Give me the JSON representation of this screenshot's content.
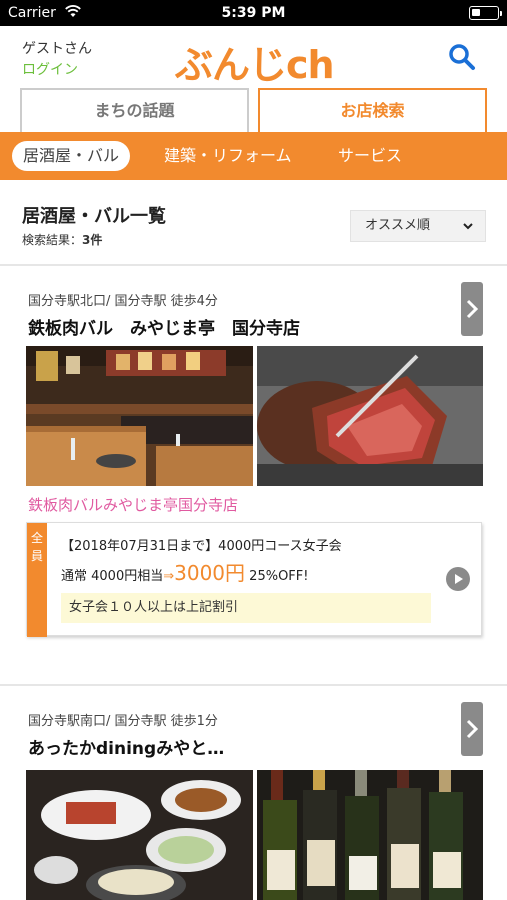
{
  "status_bar": {
    "carrier": "Carrier",
    "time": "5:39 PM"
  },
  "header": {
    "guest": "ゲストさん",
    "login": "ログイン",
    "logo": "ぶんじch"
  },
  "tabs": [
    {
      "label": "まちの話題"
    },
    {
      "label": "お店検索"
    }
  ],
  "categories": [
    {
      "label": "居酒屋・バル"
    },
    {
      "label": "建築・リフォーム"
    },
    {
      "label": "サービス"
    }
  ],
  "list": {
    "title": "居酒屋・バル一覧",
    "result_label": "検索結果：",
    "result_count": "3件",
    "sort_label": "オススメ順"
  },
  "shops": [
    {
      "meta": "国分寺駅北口/ 国分寺駅 徒歩4分",
      "name": "鉄板肉バル　みやじま亭　国分寺店",
      "subname": "鉄板肉バルみやじま亭国分寺店",
      "coupon": {
        "tag": "全員",
        "title": "【2018年07月31日まで】4000円コース女子会",
        "normal": "通常 4000円相当",
        "arrow": "⇒",
        "price": "3000円",
        "off": "25%OFF!",
        "note": "女子会１０人以上は上記割引"
      }
    },
    {
      "meta": "国分寺駅南口/ 国分寺駅 徒歩1分",
      "name": "あったかdiningみやと…"
    }
  ],
  "colors": {
    "accent": "#f28a2e",
    "login": "#6cbf3c",
    "subname": "#e05aa0",
    "search": "#1a6fd6"
  }
}
